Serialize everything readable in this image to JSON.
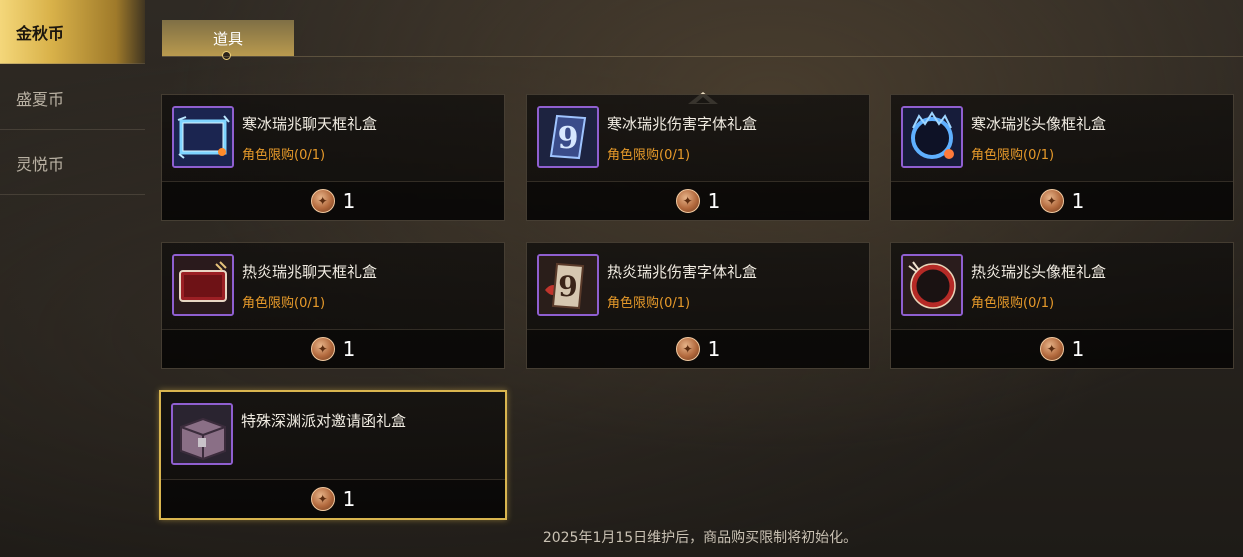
{
  "sidebar": {
    "items": [
      {
        "label": "金秋币",
        "active": true
      },
      {
        "label": "盛夏币",
        "active": false
      },
      {
        "label": "灵悦币",
        "active": false
      }
    ]
  },
  "tabs": [
    {
      "label": "道具",
      "active": true
    }
  ],
  "items": [
    {
      "name": "寒冰瑞兆聊天框礼盒",
      "limit": "角色限购(0/1)",
      "price": "1",
      "icon": "ice-chat-frame-icon"
    },
    {
      "name": "寒冰瑞兆伤害字体礼盒",
      "limit": "角色限购(0/1)",
      "price": "1",
      "icon": "ice-damage-font-icon"
    },
    {
      "name": "寒冰瑞兆头像框礼盒",
      "limit": "角色限购(0/1)",
      "price": "1",
      "icon": "ice-avatar-frame-icon"
    },
    {
      "name": "热炎瑞兆聊天框礼盒",
      "limit": "角色限购(0/1)",
      "price": "1",
      "icon": "fire-chat-frame-icon"
    },
    {
      "name": "热炎瑞兆伤害字体礼盒",
      "limit": "角色限购(0/1)",
      "price": "1",
      "icon": "fire-damage-font-icon"
    },
    {
      "name": "热炎瑞兆头像框礼盒",
      "limit": "角色限购(0/1)",
      "price": "1",
      "icon": "fire-avatar-frame-icon"
    },
    {
      "name": "特殊深渊派对邀请函礼盒",
      "limit": "",
      "price": "1",
      "icon": "abyss-invite-box-icon",
      "selected": true
    }
  ],
  "notice": "2025年1月15日维护后，商品购买限制将初始化。",
  "colors": {
    "accent_gold": "#d9b54f",
    "limit_orange": "#e79a2a",
    "rarity_purple": "#8f5fd0"
  }
}
